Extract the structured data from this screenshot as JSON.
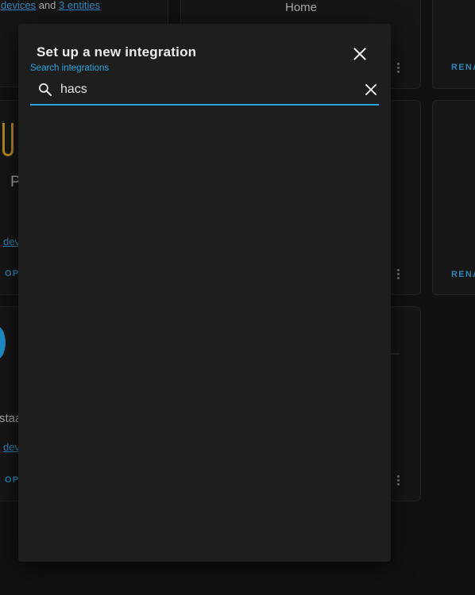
{
  "background": {
    "card1": {
      "link1": "devices",
      "and_text": "and",
      "link2": "3 entities"
    },
    "card2": {
      "title": "Home",
      "action": "RENA"
    },
    "card_mid_left": {
      "partial_title": "P",
      "link": "devi",
      "action": "OP"
    },
    "card_mid_right": {
      "action": "RENA"
    },
    "card_low_left": {
      "partial_text": "staa",
      "link": "devi",
      "action": "OP"
    }
  },
  "dialog": {
    "title": "Set up a new integration",
    "close_icon": "close-icon",
    "search": {
      "label": "Search integrations",
      "value": "hacs",
      "search_icon": "search-icon",
      "clear_icon": "close-icon"
    },
    "results": []
  },
  "colors": {
    "accent": "#2aa5de",
    "dialog_bg": "#1e1e1e",
    "page_bg": "#111111"
  }
}
